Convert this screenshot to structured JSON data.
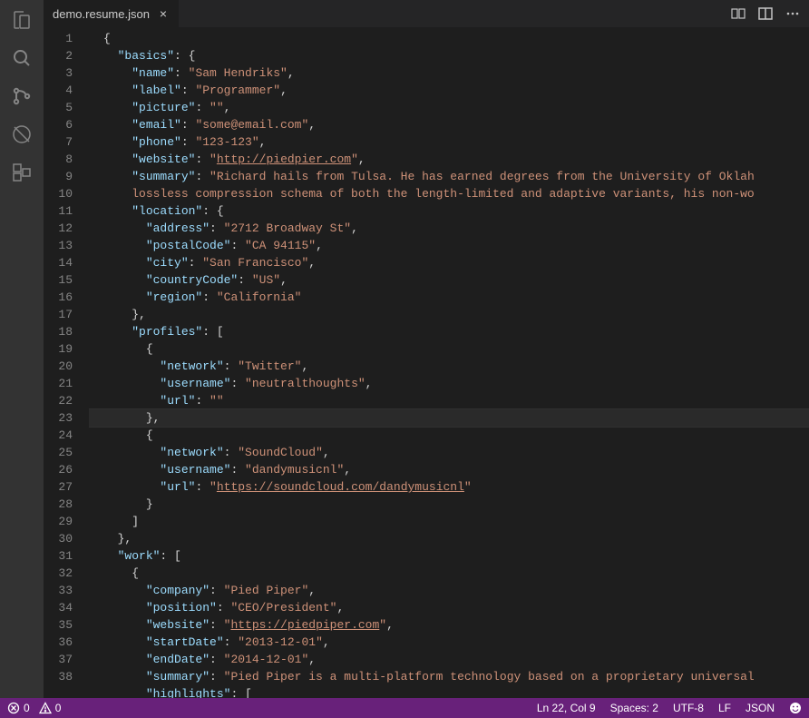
{
  "tab": {
    "name": "demo.resume.json"
  },
  "code": {
    "lines": [
      {
        "n": 1,
        "indent": 0,
        "type": "punct",
        "text": "{"
      },
      {
        "n": 2,
        "indent": 1,
        "type": "key-open",
        "key": "basics",
        "open": "{"
      },
      {
        "n": 3,
        "indent": 2,
        "type": "kv",
        "key": "name",
        "val": "Sam Hendriks",
        "comma": true
      },
      {
        "n": 4,
        "indent": 2,
        "type": "kv",
        "key": "label",
        "val": "Programmer",
        "comma": true
      },
      {
        "n": 5,
        "indent": 2,
        "type": "kv",
        "key": "picture",
        "val": "",
        "comma": true
      },
      {
        "n": 6,
        "indent": 2,
        "type": "kv",
        "key": "email",
        "val": "some@email.com",
        "comma": true
      },
      {
        "n": 7,
        "indent": 2,
        "type": "kv",
        "key": "phone",
        "val": "123-123",
        "comma": true
      },
      {
        "n": 8,
        "indent": 2,
        "type": "kv-link",
        "key": "website",
        "val": "http://piedpier.com",
        "comma": true
      },
      {
        "n": 9,
        "indent": 2,
        "type": "kv-wrap",
        "key": "summary",
        "val1": "Richard hails from Tulsa. He has earned degrees from the University of Oklah",
        "val2": "lossless compression schema of both the length-limited and adaptive variants, his non-wo"
      },
      {
        "n": 10,
        "indent": 2,
        "type": "key-open",
        "key": "location",
        "open": "{"
      },
      {
        "n": 11,
        "indent": 3,
        "type": "kv",
        "key": "address",
        "val": "2712 Broadway St",
        "comma": true
      },
      {
        "n": 12,
        "indent": 3,
        "type": "kv",
        "key": "postalCode",
        "val": "CA 94115",
        "comma": true
      },
      {
        "n": 13,
        "indent": 3,
        "type": "kv",
        "key": "city",
        "val": "San Francisco",
        "comma": true
      },
      {
        "n": 14,
        "indent": 3,
        "type": "kv",
        "key": "countryCode",
        "val": "US",
        "comma": true
      },
      {
        "n": 15,
        "indent": 3,
        "type": "kv",
        "key": "region",
        "val": "California",
        "comma": false
      },
      {
        "n": 16,
        "indent": 2,
        "type": "punct",
        "text": "},"
      },
      {
        "n": 17,
        "indent": 2,
        "type": "key-open",
        "key": "profiles",
        "open": "["
      },
      {
        "n": 18,
        "indent": 3,
        "type": "punct",
        "text": "{"
      },
      {
        "n": 19,
        "indent": 4,
        "type": "kv",
        "key": "network",
        "val": "Twitter",
        "comma": true
      },
      {
        "n": 20,
        "indent": 4,
        "type": "kv",
        "key": "username",
        "val": "neutralthoughts",
        "comma": true
      },
      {
        "n": 21,
        "indent": 4,
        "type": "kv",
        "key": "url",
        "val": "",
        "comma": false
      },
      {
        "n": 22,
        "indent": 3,
        "type": "punct",
        "text": "},",
        "current": true
      },
      {
        "n": 23,
        "indent": 3,
        "type": "punct",
        "text": "{"
      },
      {
        "n": 24,
        "indent": 4,
        "type": "kv",
        "key": "network",
        "val": "SoundCloud",
        "comma": true
      },
      {
        "n": 25,
        "indent": 4,
        "type": "kv",
        "key": "username",
        "val": "dandymusicnl",
        "comma": true
      },
      {
        "n": 26,
        "indent": 4,
        "type": "kv-link",
        "key": "url",
        "val": "https://soundcloud.com/dandymusicnl",
        "comma": false
      },
      {
        "n": 27,
        "indent": 3,
        "type": "punct",
        "text": "}"
      },
      {
        "n": 28,
        "indent": 2,
        "type": "punct",
        "text": "]"
      },
      {
        "n": 29,
        "indent": 1,
        "type": "punct",
        "text": "},"
      },
      {
        "n": 30,
        "indent": 1,
        "type": "key-open",
        "key": "work",
        "open": "["
      },
      {
        "n": 31,
        "indent": 2,
        "type": "punct",
        "text": "{"
      },
      {
        "n": 32,
        "indent": 3,
        "type": "kv",
        "key": "company",
        "val": "Pied Piper",
        "comma": true
      },
      {
        "n": 33,
        "indent": 3,
        "type": "kv",
        "key": "position",
        "val": "CEO/President",
        "comma": true
      },
      {
        "n": 34,
        "indent": 3,
        "type": "kv-link",
        "key": "website",
        "val": "https://piedpiper.com",
        "comma": true
      },
      {
        "n": 35,
        "indent": 3,
        "type": "kv",
        "key": "startDate",
        "val": "2013-12-01",
        "comma": true
      },
      {
        "n": 36,
        "indent": 3,
        "type": "kv",
        "key": "endDate",
        "val": "2014-12-01",
        "comma": true
      },
      {
        "n": 37,
        "indent": 3,
        "type": "kv-trunc",
        "key": "summary",
        "val": "Pied Piper is a multi-platform technology based on a proprietary universal"
      },
      {
        "n": 38,
        "indent": 3,
        "type": "key-open",
        "key": "highlights",
        "open": "["
      }
    ]
  },
  "status": {
    "errors": "0",
    "warnings": "0",
    "cursor": "Ln 22, Col 9",
    "spaces": "Spaces: 2",
    "encoding": "UTF-8",
    "eol": "LF",
    "lang": "JSON"
  }
}
